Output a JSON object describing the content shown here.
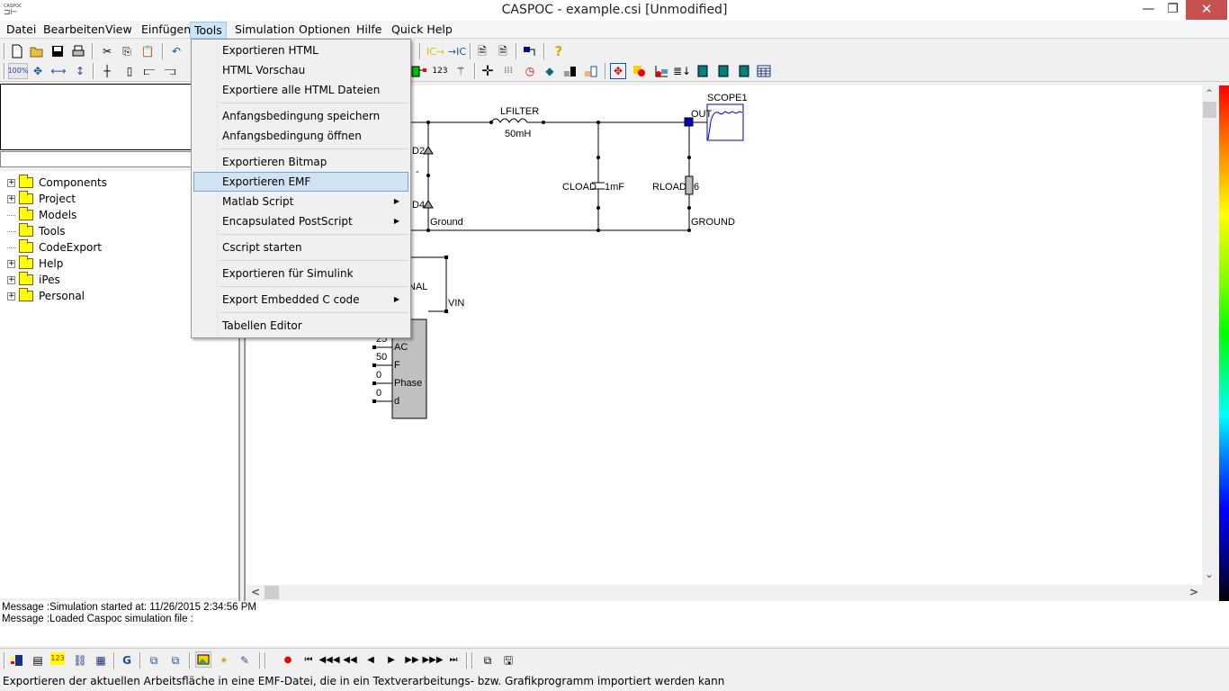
{
  "window": {
    "title": "CASPOC - example.csi [Unmodified]",
    "app_icon_label": "CASPOC",
    "minimize": "—",
    "restore": "❐",
    "close": "✕"
  },
  "menubar": [
    {
      "label": "Datei"
    },
    {
      "label": "Bearbeiten"
    },
    {
      "label": "View"
    },
    {
      "label": "Einfügen"
    },
    {
      "label": "Tools",
      "active": true
    },
    {
      "label": "Simulation"
    },
    {
      "label": "Optionen"
    },
    {
      "label": "Hilfe"
    },
    {
      "label": "Quick Help"
    }
  ],
  "toolbar1": {
    "icons": [
      "new-file",
      "open-folder",
      "save",
      "print",
      "cut",
      "copy",
      "paste",
      "undo"
    ],
    "right_icons": [
      "ic-export",
      "ic-import",
      "wizard-1",
      "wizard-2",
      "tree-view",
      "help"
    ],
    "ic_export_label": "IC→",
    "ic_import_label": "→IC",
    "help_glyph": "?"
  },
  "toolbar2": {
    "zoom_label": "100%",
    "icons": [
      "zoom-100",
      "fit-all",
      "fit-width",
      "fit-height",
      "node",
      "resistor",
      "block-1",
      "block-2"
    ],
    "right_icons": [
      "green-block",
      "number-123",
      "magic-wand",
      "crosshair",
      "grid-dots",
      "clock",
      "paint-bucket",
      "level-1",
      "level-2",
      "move",
      "shape-color",
      "graph",
      "sort",
      "uc-chip",
      "c-chip",
      "h-chip",
      "table"
    ],
    "num_label": "123"
  },
  "tools_menu": {
    "items": [
      {
        "label": "Exportieren HTML",
        "type": "item"
      },
      {
        "label": "HTML Vorschau",
        "type": "item"
      },
      {
        "label": "Exportiere alle HTML Dateien",
        "type": "item"
      },
      {
        "type": "separator"
      },
      {
        "label": "Anfangsbedingung speichern",
        "type": "item"
      },
      {
        "label": "Anfangsbedingung öffnen",
        "type": "item"
      },
      {
        "type": "separator"
      },
      {
        "label": "Exportieren Bitmap",
        "type": "item"
      },
      {
        "label": "Exportieren EMF",
        "type": "item",
        "highlighted": true
      },
      {
        "label": "Matlab Script",
        "type": "submenu"
      },
      {
        "label": "Encapsulated PostScript",
        "type": "submenu"
      },
      {
        "type": "separator"
      },
      {
        "label": "Cscript starten",
        "type": "item"
      },
      {
        "type": "separator"
      },
      {
        "label": "Exportieren für Simulink",
        "type": "item"
      },
      {
        "type": "separator"
      },
      {
        "label": "Export Embedded C code",
        "type": "submenu"
      },
      {
        "type": "separator"
      },
      {
        "label": "Tabellen Editor",
        "type": "item"
      }
    ]
  },
  "tree": {
    "items": [
      {
        "label": "Components",
        "expandable": true
      },
      {
        "label": "Project",
        "expandable": true
      },
      {
        "label": "Models",
        "expandable": false
      },
      {
        "label": "Tools",
        "expandable": false
      },
      {
        "label": "CodeExport",
        "expandable": false
      },
      {
        "label": "Help",
        "expandable": true
      },
      {
        "label": "iPes",
        "expandable": true
      },
      {
        "label": "Personal",
        "expandable": true
      }
    ]
  },
  "schematic": {
    "lfilter_name": "LFILTER",
    "lfilter_value": "50mH",
    "d2": "D2",
    "d4": "D4",
    "dash": "-",
    "ground_left": "Ground",
    "cload_name": "CLOAD",
    "cload_value": "1mF",
    "rload_name": "RLOAD",
    "rload_value": "6",
    "ground_right": "GROUND",
    "out_label": "OUT",
    "scope_name": "SCOPE1",
    "signal_name": "NAL",
    "vin_label": "VIN",
    "inputs": [
      {
        "value": "25",
        "label": "AC"
      },
      {
        "value": "50",
        "label": "F"
      },
      {
        "value": "0",
        "label": "Phase"
      },
      {
        "value": "0",
        "label": "d"
      }
    ]
  },
  "messages": [
    "Message :Simulation started at: 11/26/2015 2:34:56 PM",
    "Message :Loaded Caspoc simulation file :"
  ],
  "bottom_toolbar": {
    "icons": [
      "component-lib",
      "text-doc",
      "numeric-display",
      "hierarchy",
      "chip",
      "refresh",
      "window-1",
      "window-2",
      "image-export",
      "wizard-export",
      "probe",
      "record",
      "go-start",
      "fast-rewind",
      "rewind",
      "step-back",
      "play",
      "step-forward",
      "fast-forward",
      "go-end",
      "cascade-windows",
      "save-all"
    ]
  },
  "status": {
    "text": "Exportieren der aktuellen Arbeitsfläche in eine EMF-Datei, die in ein Textverarbeitungs- bzw. Grafikprogramm importiert werden kann"
  },
  "scrollbars": {
    "up": "⌃",
    "down": "⌄",
    "left": "<",
    "right": ">"
  }
}
